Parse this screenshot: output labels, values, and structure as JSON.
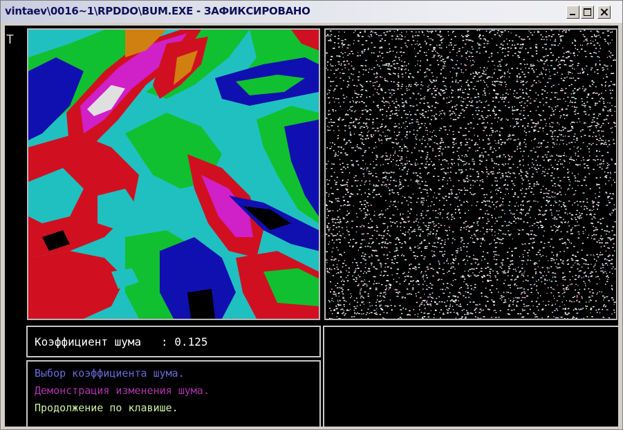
{
  "window": {
    "title": "vintaev\\0016~1\\RPDDO\\BUM.EXE - ЗАФИКСИРОВАНО",
    "controls": {
      "minimize": "minimize-icon",
      "maximize": "maximize-icon",
      "close": "close-icon"
    }
  },
  "console": {
    "cursor_glyph": "T",
    "noise_label": "Коэффициент шума",
    "noise_separator": ":",
    "noise_value": "0.125",
    "menu": [
      {
        "text": "Выбор коэффициента шума.",
        "color": "#6a6ad8"
      },
      {
        "text": "Демонстрация изменения шума.",
        "color": "#b030b0"
      },
      {
        "text": "Продолжение по клавише.",
        "color": "#c8f0a0"
      }
    ]
  },
  "palette": {
    "cyan": "#20c0c0",
    "green": "#10c030",
    "red": "#d01020",
    "magenta": "#d020c8",
    "blue": "#1010b0",
    "orange": "#d08010",
    "black": "#000000",
    "white": "#e0e0e0"
  }
}
